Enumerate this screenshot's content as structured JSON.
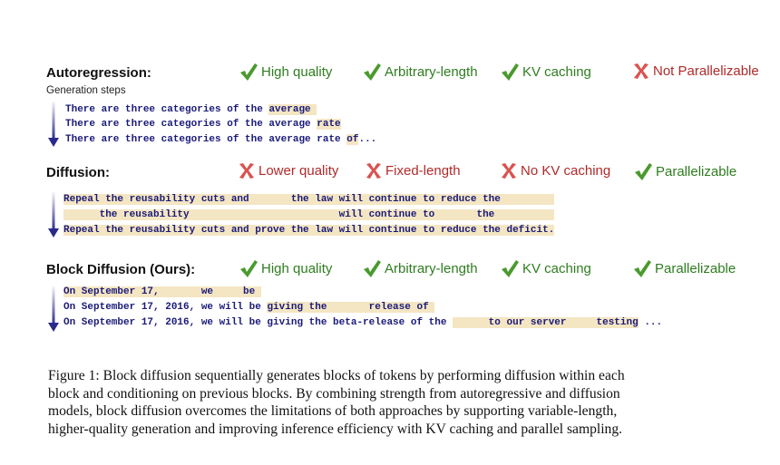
{
  "sections": {
    "autoregression": {
      "title": "Autoregression:",
      "subtitle": "Generation steps",
      "properties": [
        {
          "icon": "check",
          "label": "High quality",
          "good": true
        },
        {
          "icon": "check",
          "label": "Arbitrary-length",
          "good": true
        },
        {
          "icon": "check",
          "label": "KV caching",
          "good": true
        },
        {
          "icon": "cross",
          "label": "Not Parallelizable",
          "good": false
        }
      ],
      "lines": [
        {
          "plain": "There are three categories of the ",
          "hl": "average "
        },
        {
          "plain": "There are three categories of the average ",
          "hl": "rate"
        },
        {
          "plain": "There are three categories of the average rate ",
          "hl": "of",
          "tail": "..."
        }
      ]
    },
    "diffusion": {
      "title": "Diffusion:",
      "properties": [
        {
          "icon": "cross",
          "label": "Lower quality",
          "good": false
        },
        {
          "icon": "cross",
          "label": "Fixed-length",
          "good": false
        },
        {
          "icon": "cross",
          "label": "No KV caching",
          "good": false
        },
        {
          "icon": "check",
          "label": "Parallelizable",
          "good": true
        }
      ],
      "lines": [
        "Repeal the reusability cuts and       the law will continue to reduce the         ",
        "      the reusability                         will continue to       the          ",
        "Repeal the reusability cuts and prove the law will continue to reduce the deficit."
      ]
    },
    "block_diffusion": {
      "title": "Block Diffusion (Ours):",
      "properties": [
        {
          "icon": "check",
          "label": "High quality",
          "good": true
        },
        {
          "icon": "check",
          "label": "Arbitrary-length",
          "good": true
        },
        {
          "icon": "check",
          "label": "KV caching",
          "good": true
        },
        {
          "icon": "check",
          "label": "Parallelizable",
          "good": true
        }
      ],
      "lines": [
        {
          "hl": "On September 17,       we     be "
        },
        {
          "plain": "On September 17, 2016, we will be ",
          "hl": "giving the       release of "
        },
        {
          "plain": "On September 17, 2016, we will be giving the beta-release of the ",
          "hl": "      to our server     testing",
          "tail": " ..."
        }
      ]
    }
  },
  "caption": {
    "lines": [
      "Figure 1: Block diffusion sequentially generates blocks of tokens by performing diffusion within each",
      "block and conditioning on previous blocks. By combining strength from autoregressive and diffusion",
      "models, block diffusion overcomes the limitations of both approaches by supporting variable-length,",
      "higher-quality generation and improving inference efficiency with KV caching and parallel sampling."
    ]
  },
  "colors": {
    "good": "#2e7d1f",
    "check": "#4a9a2e",
    "bad": "#b02a2a",
    "cross": "#d9534f",
    "highlight": "#f4e6c3",
    "token_text": "#1a1a7a",
    "arrow": "#2a2a8a"
  }
}
